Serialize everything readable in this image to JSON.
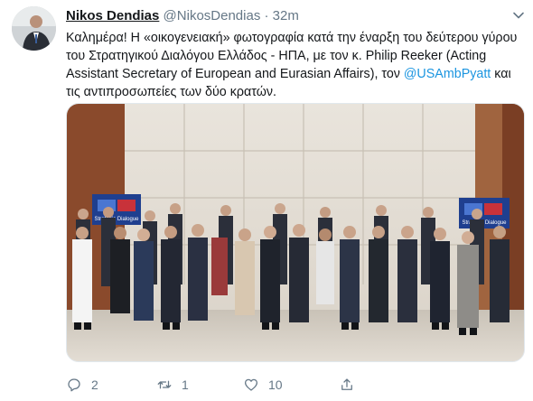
{
  "tweet": {
    "author_name": "Nikos Dendias",
    "handle": "@NikosDendias",
    "separator": "·",
    "time": "32m",
    "text_before": "Καλημέρα! Η «οικογενειακή» φωτογραφία κατά την έναρξη του δεύτερου γύρου του Στρατηγικού Διαλόγου Ελλάδος - ΗΠΑ, με τον κ. Philip Reeker (Acting Assistant Secretary of European and Eurasian Affairs), τον ",
    "mention": "@USAmbPyatt",
    "text_after": " και τις αντιπροσωπείες των δύο κρατών.",
    "photo_banner_text": "Strategic Dialogue",
    "counts": {
      "replies": "2",
      "retweets": "1",
      "likes": "10"
    }
  },
  "icons": {
    "reply": "speech-bubble-icon",
    "retweet": "retweet-arrows-icon",
    "like": "heart-outline-icon",
    "share": "share-upload-icon",
    "caret": "chevron-down-icon"
  },
  "colors": {
    "link": "#1b95e0",
    "muted": "#657786",
    "text": "#14171a"
  }
}
